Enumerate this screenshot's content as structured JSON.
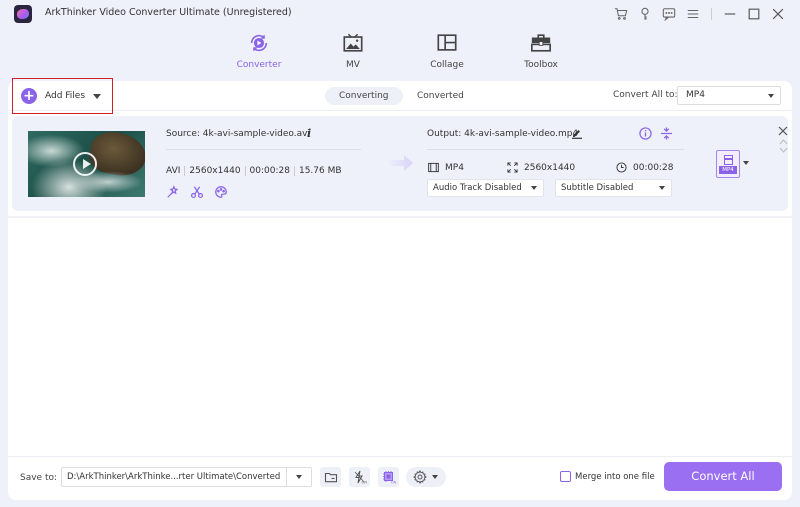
{
  "window": {
    "title": "ArkThinker Video Converter Ultimate (Unregistered)",
    "icons": [
      "cart-icon",
      "key-icon",
      "chat-icon",
      "menu-icon",
      "minimize-icon",
      "maximize-icon",
      "close-icon"
    ]
  },
  "nav": {
    "items": [
      {
        "label": "Converter",
        "icon": "converter-icon",
        "active": true
      },
      {
        "label": "MV",
        "icon": "mv-icon",
        "active": false
      },
      {
        "label": "Collage",
        "icon": "collage-icon",
        "active": false
      },
      {
        "label": "Toolbox",
        "icon": "toolbox-icon",
        "active": false
      }
    ]
  },
  "toolbar": {
    "add_files_label": "Add Files",
    "tabs": [
      {
        "label": "Converting",
        "active": true
      },
      {
        "label": "Converted",
        "active": false
      }
    ],
    "convert_all_to_label": "Convert All to:",
    "convert_all_to_value": "MP4"
  },
  "file": {
    "source_label": "Source: 4k-avi-sample-video.avi",
    "source_format": "AVI",
    "source_resolution": "2560x1440",
    "source_duration": "00:00:28",
    "source_size": "15.76 MB",
    "output_label": "Output: 4k-avi-sample-video.mp4",
    "output_format": "MP4",
    "output_resolution": "2560x1440",
    "output_duration": "00:00:28",
    "audio_track": "Audio Track Disabled",
    "subtitle": "Subtitle Disabled",
    "format_badge": "MP4"
  },
  "bottom": {
    "save_to_label": "Save to:",
    "save_path": "D:\\ArkThinker\\ArkThinke...rter Ultimate\\Converted",
    "merge_label": "Merge into one file",
    "merge_checked": false,
    "convert_all_label": "Convert All",
    "accelerate_state": "OFF",
    "gpu_state": "ON"
  },
  "colors": {
    "accent": "#8a63e8",
    "convert_button": "#9a6ff2",
    "highlight_border": "#d0202a",
    "background": "#eef0fa"
  }
}
